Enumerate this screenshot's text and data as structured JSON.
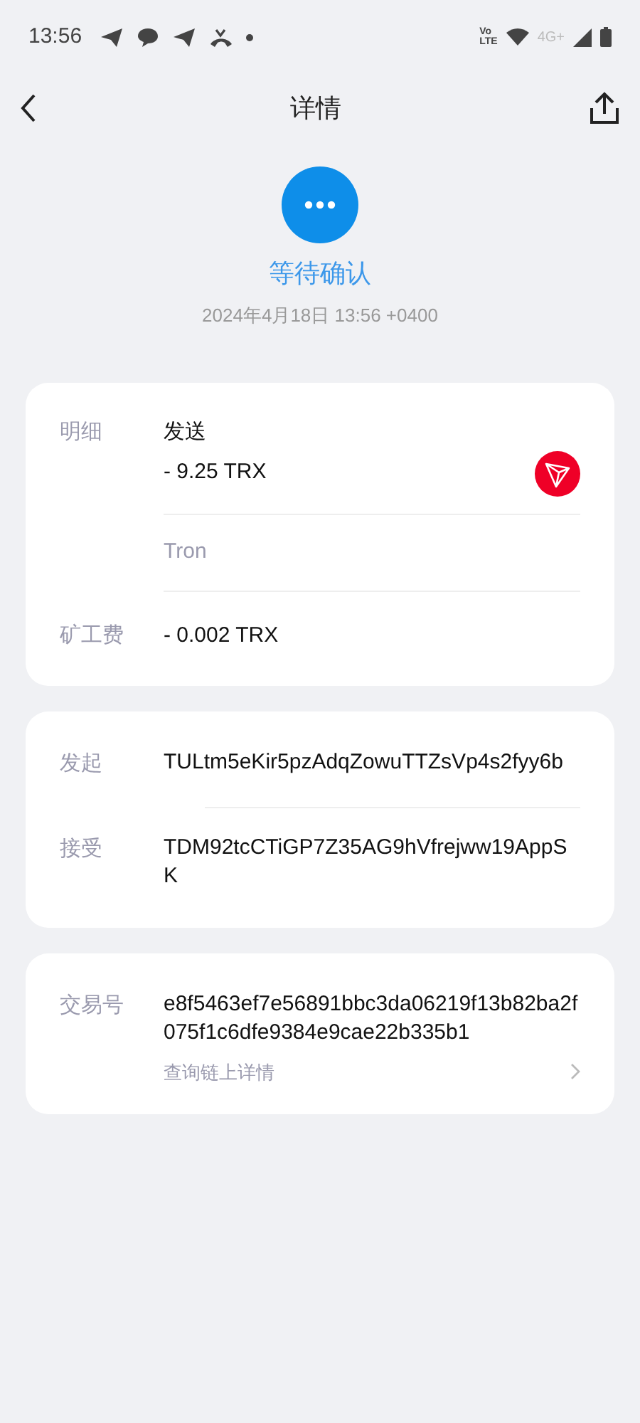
{
  "status_bar": {
    "time": "13:56",
    "volte_top": "Vo",
    "volte_bottom": "LTE",
    "network": "4G+"
  },
  "header": {
    "title": "详情"
  },
  "status": {
    "label": "等待确认",
    "date": "2024年4月18日 13:56 +0400"
  },
  "detail_card": {
    "label": "明细",
    "direction": "发送",
    "amount": "- 9.25 TRX",
    "network": "Tron",
    "fee_label": "矿工费",
    "fee": "- 0.002 TRX"
  },
  "address_card": {
    "rows": [
      {
        "label": "发起",
        "value": "TULtm5eKir5pzAdqZowuTTZsVp4s2fyy6b"
      },
      {
        "label": "接受",
        "value": "TDM92tcCTiGP7Z35AG9hVfrejww19AppSK"
      }
    ]
  },
  "tx_card": {
    "label": "交易号",
    "value": "e8f5463ef7e56891bbc3da06219f13b82ba2f075f1c6dfe9384e9cae22b335b1",
    "link": "查询链上详情"
  }
}
